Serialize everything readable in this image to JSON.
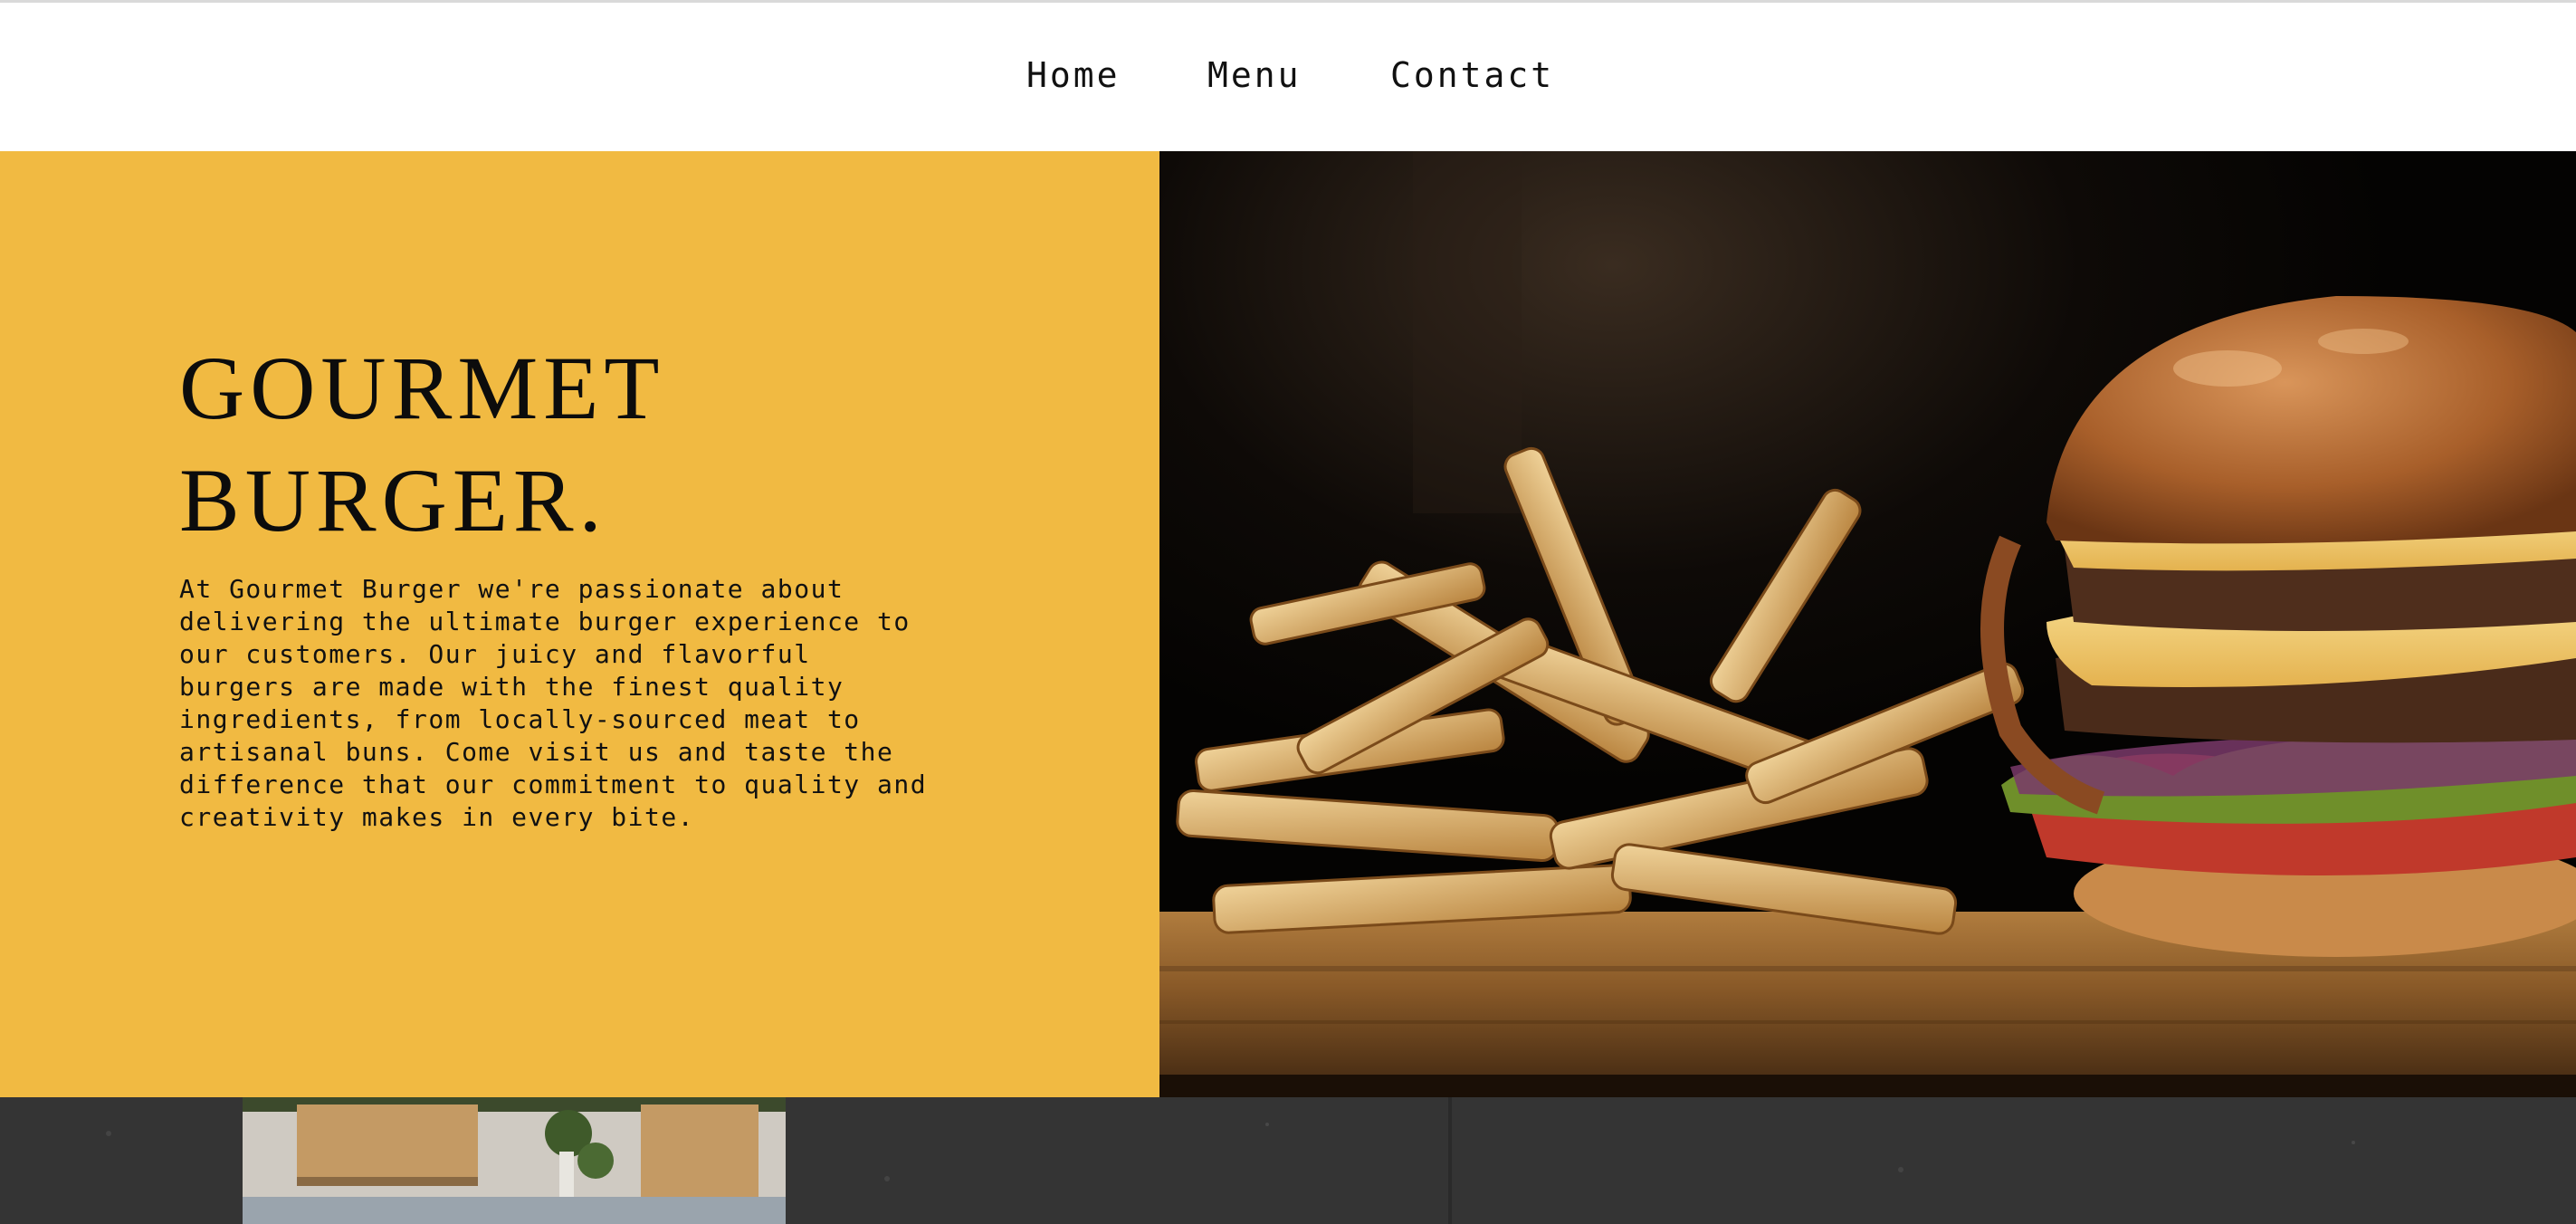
{
  "nav": {
    "links": [
      {
        "label": "Home"
      },
      {
        "label": "Menu"
      },
      {
        "label": "Contact"
      }
    ]
  },
  "hero": {
    "title_line1": "GOURMET",
    "title_line2": "BURGER.",
    "description": "At Gourmet Burger we're passionate about\ndelivering the ultimate burger experience to\nour customers. Our juicy and flavorful\nburgers are made with the finest quality\ningredients, from locally-sourced meat to\nartisanal buns. Come visit us and taste the\ndifference that our commitment to quality and\ncreativity makes in every bite.",
    "image_icon": "burger-and-fries-photo"
  },
  "colors": {
    "accent": "#f1ba42",
    "text": "#0c0c0c",
    "nav_background": "#ffffff",
    "bottom_band": "#333333"
  }
}
